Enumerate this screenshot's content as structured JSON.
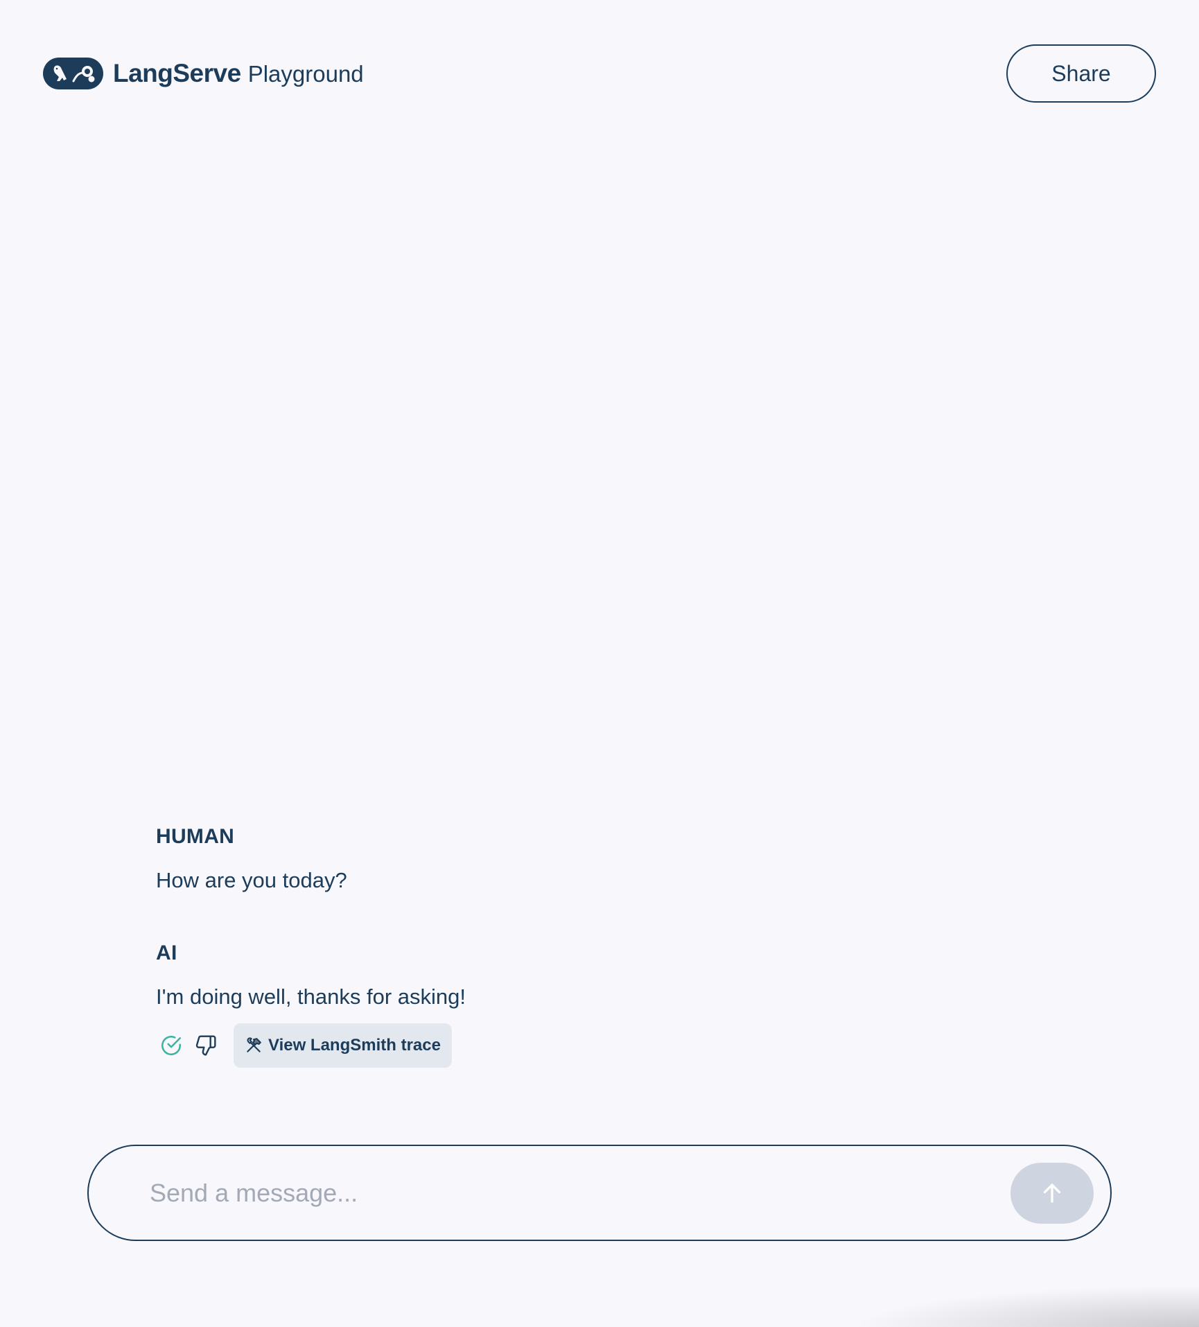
{
  "header": {
    "brand_name": "LangServe",
    "brand_sub": "Playground",
    "share_label": "Share"
  },
  "messages": [
    {
      "role": "HUMAN",
      "text": "How are you today?"
    },
    {
      "role": "AI",
      "text": "I'm doing well, thanks for asking!"
    }
  ],
  "feedback": {
    "thumbs_up_icon": "check-circle-icon",
    "thumbs_down_icon": "thumbs-down-icon",
    "trace_icon": "hammer-wrench-icon",
    "trace_label": "View LangSmith trace"
  },
  "composer": {
    "placeholder": "Send a message...",
    "value": ""
  },
  "colors": {
    "background": "#f7f7fc",
    "primary": "#1c3c5a",
    "accent_check": "#3cb4a0",
    "trace_bg": "#e3e8ef",
    "send_disabled": "#cfd5e0",
    "placeholder": "#a3a9b5"
  }
}
